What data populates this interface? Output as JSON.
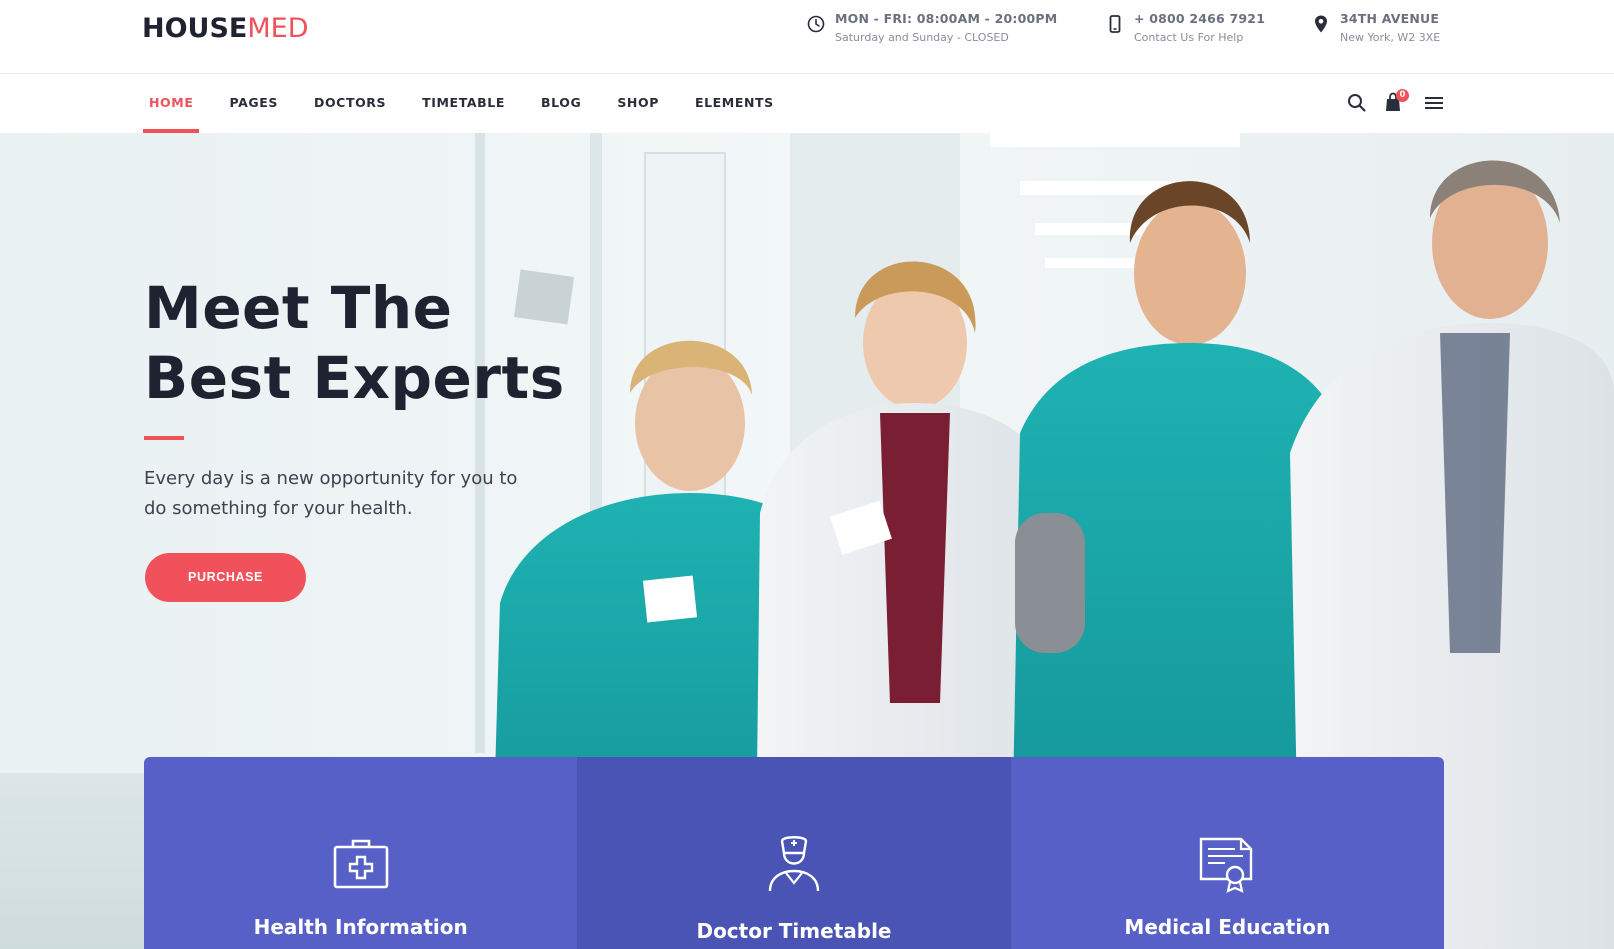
{
  "brand": {
    "part1": "HOUSE",
    "part2": "MED",
    "accent": "#f0515a"
  },
  "top_info": {
    "hours": {
      "icon": "clock-icon",
      "title": "MON - FRI: 08:00AM - 20:00PM",
      "subtitle": "Saturday and Sunday - CLOSED"
    },
    "phone": {
      "icon": "mobile-phone-icon",
      "title": "+ 0800 2466 7921",
      "subtitle": "Contact Us For Help"
    },
    "address": {
      "icon": "map-pin-icon",
      "title": "34TH AVENUE",
      "subtitle": "New York, W2 3XE"
    }
  },
  "nav": {
    "items": [
      {
        "label": "HOME",
        "active": true
      },
      {
        "label": "PAGES"
      },
      {
        "label": "DOCTORS"
      },
      {
        "label": "TIMETABLE"
      },
      {
        "label": "BLOG"
      },
      {
        "label": "SHOP"
      },
      {
        "label": "ELEMENTS"
      }
    ],
    "tools": {
      "search": "search-icon",
      "cart": "shopping-bag-icon",
      "cart_count": "0",
      "menu": "hamburger-menu-icon"
    }
  },
  "hero": {
    "title_line1": "Meet The",
    "title_line2": "Best Experts",
    "subtitle": "Every day is a new opportunity for you to do something for your health.",
    "button_label": "PURCHASE"
  },
  "features": [
    {
      "title": "Health Information",
      "icon": "first-aid-kit-icon"
    },
    {
      "title": "Doctor Timetable",
      "icon": "nurse-icon"
    },
    {
      "title": "Medical Education",
      "icon": "certificate-icon"
    }
  ],
  "colors": {
    "accent": "#f0515a",
    "card": "#5760c6",
    "card_mid": "#4a54b5",
    "text_dark": "#1f2230"
  }
}
